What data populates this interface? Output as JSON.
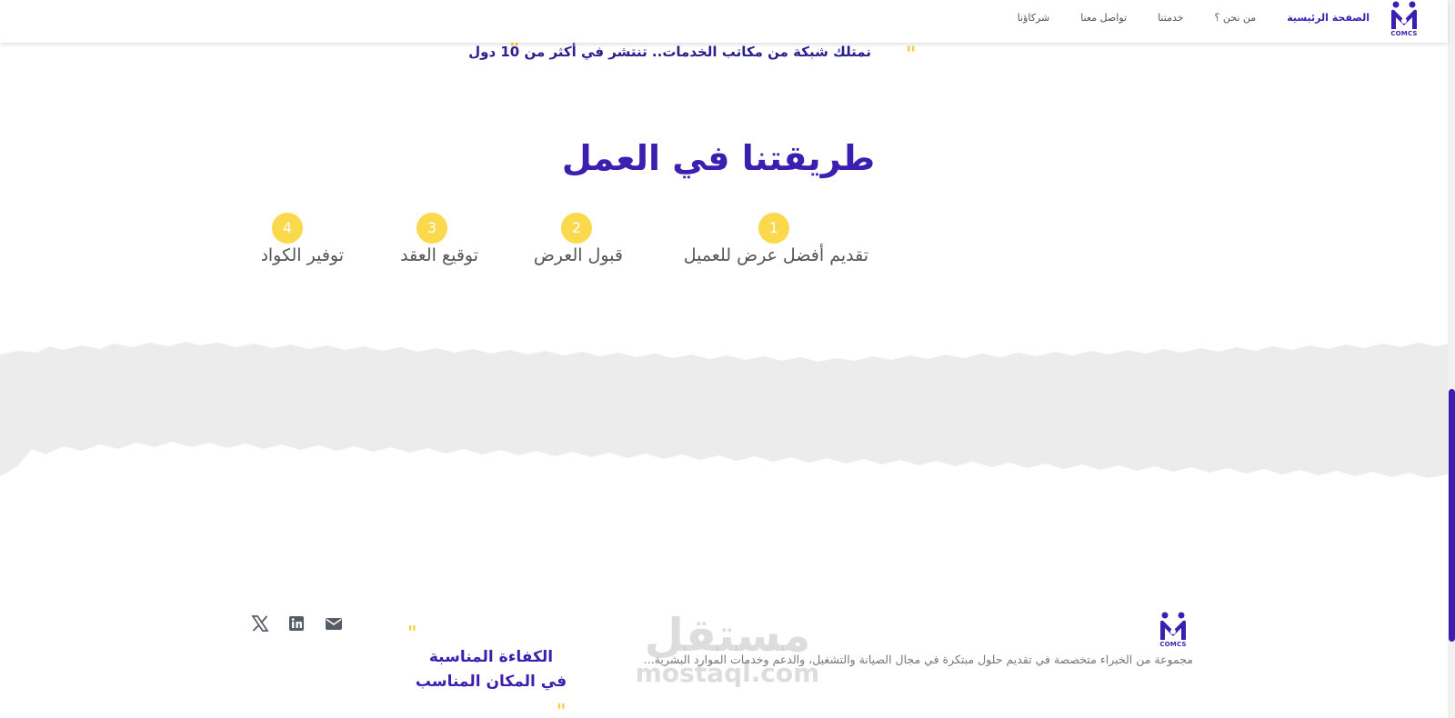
{
  "brand": {
    "logo_text": "COMCS",
    "primary_color": "#3b1fb0",
    "accent_color": "#fbd94d"
  },
  "nav": {
    "items": [
      {
        "label": "الصفحة الرئيسية",
        "active": true
      },
      {
        "label": "من نحن ؟"
      },
      {
        "label": "خدمتنا"
      },
      {
        "label": "تواصل معنا"
      },
      {
        "label": "شركاؤنا"
      }
    ]
  },
  "tagline": {
    "text": "نمتلك شبكة من مكاتب الخدمات.. تنتشر في أكثر من 10 دول"
  },
  "process": {
    "title": "طريقتنا في العمل",
    "steps": [
      {
        "number": "1",
        "title": "تقديم أفضل عرض للعميل"
      },
      {
        "number": "2",
        "title": "قبول العرض"
      },
      {
        "number": "3",
        "title": "توقيع العقد"
      },
      {
        "number": "4",
        "title": "توفير الكوادر"
      }
    ]
  },
  "footer": {
    "logo_text": "COMCS",
    "description": "مجموعة من الخبراء متخصصة في تقديم حلول مبتكرة في مجال الصيانة والتشغيل، والدعم وخدمات الموارد البشرية...",
    "slogan_line1": "الكفاءة المناسبة",
    "slogan_line2": "في المكان المناسب",
    "social_icons": [
      "email-icon",
      "linkedin-icon",
      "x-icon"
    ]
  },
  "watermark": {
    "arabic": "مستقل",
    "latin": "mostaql.com"
  }
}
